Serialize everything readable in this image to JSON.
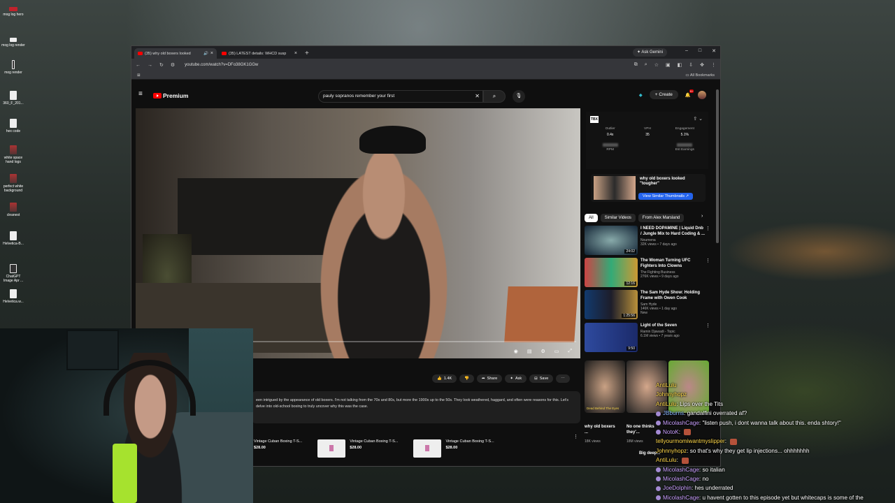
{
  "desktop": {
    "icons": [
      {
        "label": "mog log hero"
      },
      {
        "label": "mog log render"
      },
      {
        "label": "mog render"
      },
      {
        "label": "360_F_201..."
      },
      {
        "label": "hex code"
      },
      {
        "label": "white space hand logs"
      },
      {
        "label": "perfect white background"
      },
      {
        "label": "cleanest"
      },
      {
        "label": "Helvetica-B..."
      },
      {
        "label": "ChatGPT Image Apr ..."
      },
      {
        "label": "Helvetica.w..."
      }
    ]
  },
  "browser": {
    "tabs": [
      {
        "title": "(35) why old boxers looked"
      },
      {
        "title": "(35) LATEST details: WHCD susp"
      }
    ],
    "ask_gemini": "Ask Gemini",
    "url": "youtube.com/watch?v=DFo38GK1GGw",
    "all_bookmarks": "All Bookmarks"
  },
  "youtube": {
    "logo": "Premium",
    "search_value": "pauly sopranos remember your first",
    "create_label": "Create",
    "notif_count": "9+",
    "actions": {
      "likes": "1.4K",
      "share": "Share",
      "ask": "Ask",
      "save": "Save"
    },
    "description": "een intrigued by the appearance of old boxers. I'm not talking from the 70s and 80s, but more the 1900s up to the 50s. They look weathered, haggard, and often were reasons for this. Let's delve into old-school boxing to truly uncover why this was the case.",
    "merch": [
      {
        "title": "Vintage Cuban Boxing T-S...",
        "price": "$28.00"
      },
      {
        "title": "Vintage Cuban Boxing T-S...",
        "price": "$28.00"
      },
      {
        "title": "Vintage Cuban Boxing T-S...",
        "price": "$28.00"
      }
    ],
    "extension": {
      "logo": "TBX",
      "metrics": [
        {
          "label": "Outlier",
          "value": "0.4x"
        },
        {
          "label": "VPH",
          "value": "35"
        },
        {
          "label": "Engagement",
          "value": "5.1%"
        }
      ],
      "hidden": [
        {
          "label": "RPM"
        },
        {
          "label": "Est Earnings"
        }
      ],
      "card_title": "why old boxers looked \"tougher\"",
      "card_button": "View Similar Thumbnails"
    },
    "chips": [
      "All",
      "Similar Videos",
      "From Alex Marsland"
    ],
    "recommendations": [
      {
        "title": "I NEED DOPAMINE | Liquid Dnb / Jungle Mix to Hard Coding & ...",
        "channel": "Noumena",
        "meta": "32K views • 7 days ago",
        "duration": "24:02"
      },
      {
        "title": "The Woman Turning UFC Fighters Into Clowns",
        "channel": "The Fighting Business",
        "meta": "276K views • 9 days ago",
        "duration": "12:16"
      },
      {
        "title": "The Sam Hyde Show: Holding Frame with Owen Cook",
        "channel": "Sam Hyde",
        "meta": "146K views • 1 day ago",
        "duration": "1:25:56",
        "badge": "New"
      },
      {
        "title": "Light of the Seven",
        "channel": "Ramin Djawadi - Topic",
        "meta": "6.1M views • 7 years ago",
        "duration": "9:50"
      }
    ],
    "shorts": [
      {
        "title": "why old boxers ...",
        "views": "18K views",
        "caption": "Dead Behind The Eyes"
      },
      {
        "title": "No one thinks they'...",
        "views": "18M views"
      }
    ],
    "shorts_more": "Big deep..."
  },
  "chat": [
    {
      "user": "AntiLulu",
      "msg": "",
      "color": "y"
    },
    {
      "user": "Johnnyhopz",
      "msg": "",
      "color": "y"
    },
    {
      "user": "AntiLulu",
      "msg": "Lips over the Tits",
      "color": "y"
    },
    {
      "user": "JBburns",
      "msg": "gandalfini overrated af?",
      "color": "b"
    },
    {
      "user": "MicolashCage",
      "msg": "\"listen push, i dont wanna talk about this. enda shtory!\"",
      "color": "p"
    },
    {
      "user": "NotoK",
      "msg": "",
      "color": "p"
    },
    {
      "user": "tellyourmomiwantmyslipper",
      "msg": "",
      "color": "y"
    },
    {
      "user": "Johnnyhopz",
      "msg": "so that's why they get lip injections... ohhhhhhh",
      "color": "y"
    },
    {
      "user": "AntiLulu",
      "msg": "",
      "color": "y"
    },
    {
      "user": "MicolashCage",
      "msg": "so italian",
      "color": "p"
    },
    {
      "user": "MicolashCage",
      "msg": "no",
      "color": "p"
    },
    {
      "user": "JoeDolphin",
      "msg": "hes underrated",
      "color": "p"
    },
    {
      "user": "MicolashCage",
      "msg": "u havent gotten to this episode yet but whitecaps is some of the",
      "color": "p"
    }
  ]
}
